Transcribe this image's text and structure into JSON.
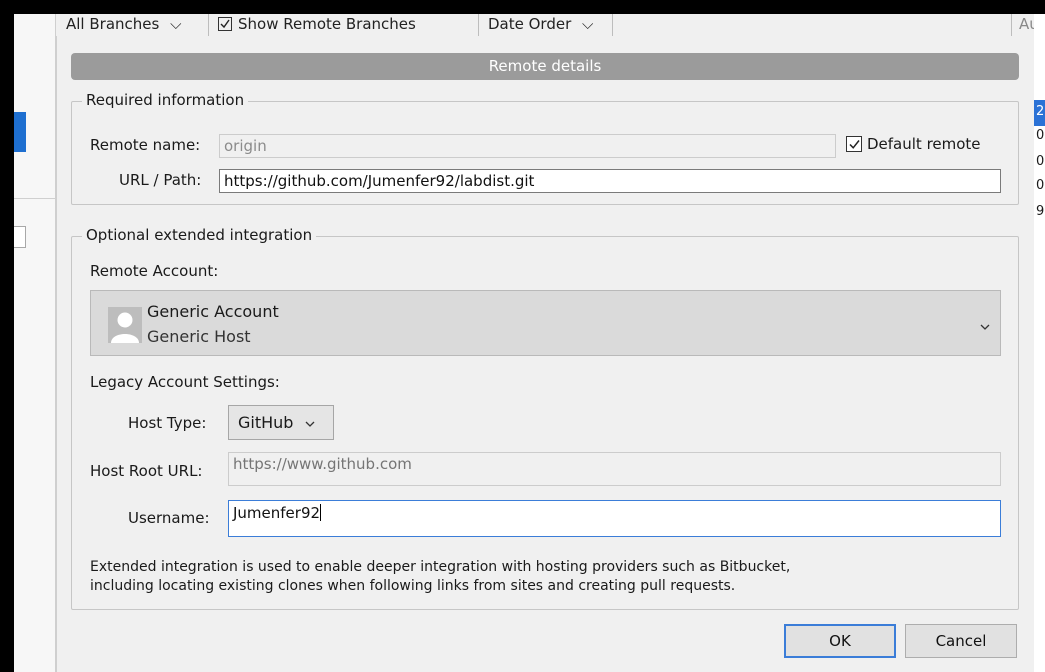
{
  "background_app": {
    "toolbar": {
      "branches_label": "All Branches",
      "show_remote_label": "Show Remote Branches",
      "order_label": "Date Order",
      "author_clip": "Au"
    },
    "right_column_clips": [
      "2",
      "0",
      "0",
      "0",
      "9"
    ]
  },
  "dialog": {
    "title": "Remote details",
    "required": {
      "legend": "Required information",
      "remote_name_label": "Remote name:",
      "remote_name_value": "origin",
      "default_remote_label": "Default remote",
      "url_label": "URL / Path:",
      "url_value": "https://github.com/Jumenfer92/labdist.git"
    },
    "optional": {
      "legend": "Optional extended integration",
      "remote_account_label": "Remote Account:",
      "account_name": "Generic Account",
      "account_host": "Generic Host",
      "legacy_label": "Legacy Account Settings:",
      "host_type_label": "Host Type:",
      "host_type_value": "GitHub",
      "host_root_label": "Host Root URL:",
      "host_root_placeholder": "https://www.github.com",
      "username_label": "Username:",
      "username_value": "Jumenfer92",
      "note_line1": "Extended integration is used to enable deeper integration with hosting providers such as Bitbucket,",
      "note_line2": "including locating existing clones when following links from sites and creating pull requests."
    },
    "buttons": {
      "ok": "OK",
      "cancel": "Cancel"
    }
  },
  "colors": {
    "accent": "#3b7dd8",
    "titlebar": "#9b9b9b",
    "dialog_bg": "#f0f0f0"
  }
}
